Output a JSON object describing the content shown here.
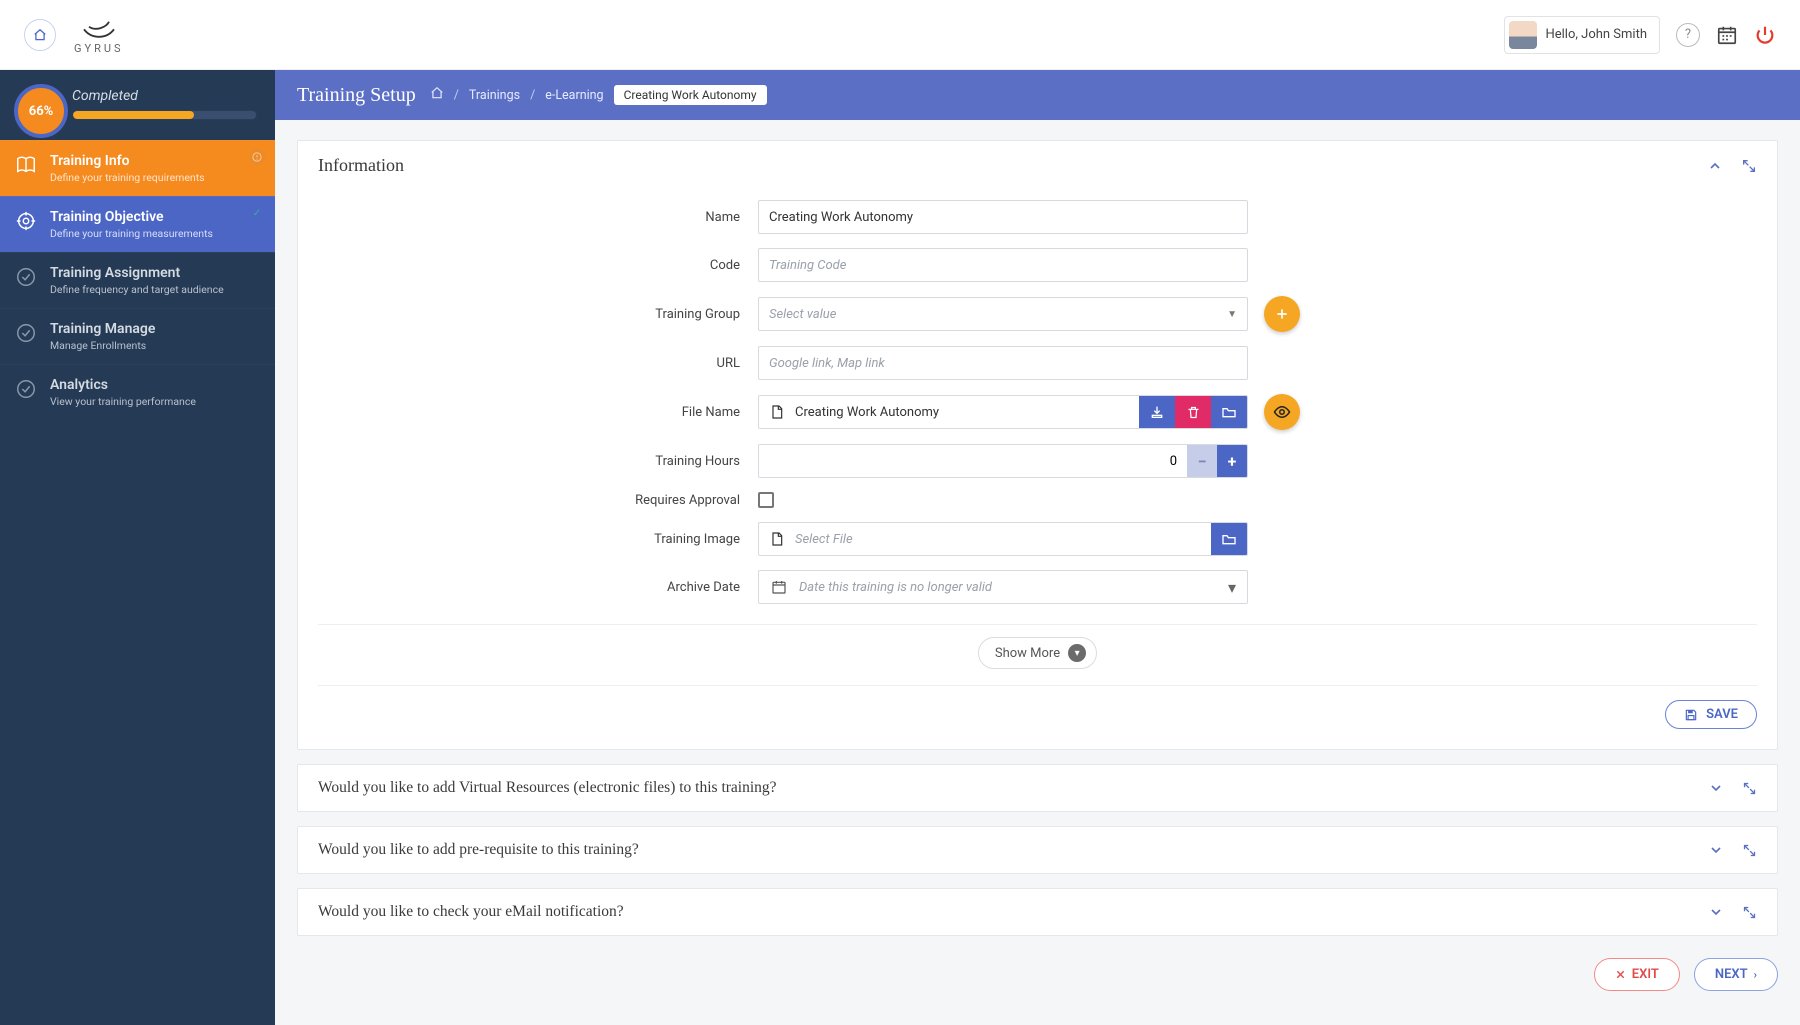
{
  "topbar": {
    "greeting": "Hello, John Smith",
    "logo_text": "GYRUS"
  },
  "sidebar": {
    "progress": {
      "label": "Completed",
      "percent_text": "66%",
      "percent": 66
    },
    "steps": [
      {
        "title": "Training Info",
        "sub": "Define your training requirements"
      },
      {
        "title": "Training Objective",
        "sub": "Define your training measurements"
      },
      {
        "title": "Training Assignment",
        "sub": "Define frequency and target audience"
      },
      {
        "title": "Training Manage",
        "sub": "Manage Enrollments"
      },
      {
        "title": "Analytics",
        "sub": "View your training performance"
      }
    ]
  },
  "header": {
    "title": "Training Setup",
    "crumbs": {
      "trainings": "Trainings",
      "elearning": "e-Learning",
      "current": "Creating Work Autonomy"
    }
  },
  "panel_info": {
    "title": "Information",
    "labels": {
      "name": "Name",
      "code": "Code",
      "training_group": "Training Group",
      "url": "URL",
      "file_name": "File Name",
      "training_hours": "Training Hours",
      "requires_approval": "Requires Approval",
      "training_image": "Training Image",
      "archive_date": "Archive Date"
    },
    "values": {
      "name": "Creating Work Autonomy",
      "file_name": "Creating Work Autonomy",
      "training_hours": "0"
    },
    "placeholders": {
      "code": "Training Code",
      "training_group": "Select value",
      "url": "Google link, Map link",
      "training_image": "Select File",
      "archive_date": "Date this training is no longer valid"
    },
    "show_more": "Show More",
    "save": "SAVE"
  },
  "collapsed_panels": {
    "virtual": "Would you like to add Virtual Resources (electronic files) to this training?",
    "prereq": "Would you like to add pre-requisite to this training?",
    "email": "Would you like to check your eMail notification?"
  },
  "footer": {
    "exit": "EXIT",
    "next": "NEXT"
  }
}
